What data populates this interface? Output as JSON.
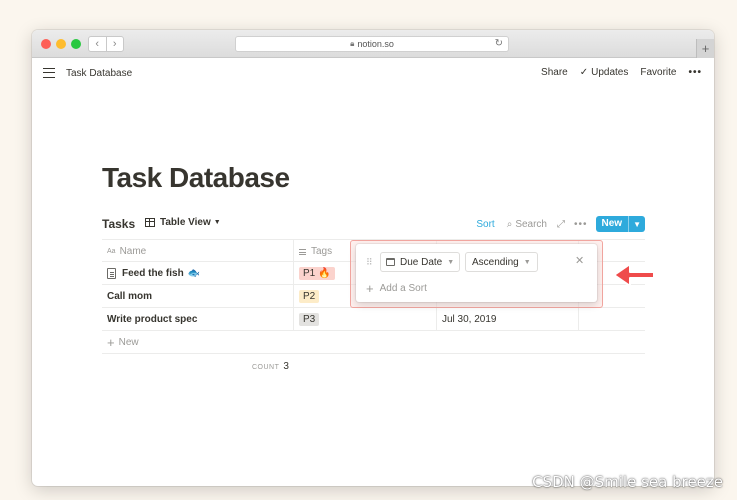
{
  "browser": {
    "url": "notion.so",
    "new_tab_symbol": "+"
  },
  "topbar": {
    "breadcrumb": "Task Database",
    "share_label": "Share",
    "updates_label": "Updates",
    "favorite_label": "Favorite",
    "more_symbol": "•••"
  },
  "page": {
    "title": "Task Database"
  },
  "database": {
    "name": "Tasks",
    "view_label": "Table View",
    "sort_label": "Sort",
    "search_label": "Search",
    "new_label": "New",
    "columns": [
      "Name",
      "Tags"
    ],
    "rows": [
      {
        "name": "Feed the fish",
        "emoji": "🐟",
        "tag": "P1",
        "tag_extra": "🔥",
        "date": ""
      },
      {
        "name": "Call mom",
        "tag": "P2",
        "date": ""
      },
      {
        "name": "Write product spec",
        "tag": "P3",
        "date": "Jul 30, 2019"
      }
    ],
    "new_row_label": "New",
    "count_label": "COUNT",
    "count_value": "3"
  },
  "sort_popup": {
    "property_label": "Due Date",
    "direction_label": "Ascending",
    "add_sort_label": "Add a Sort"
  },
  "help_symbol": "?",
  "watermark": "CSDN @Smile sea breeze",
  "colors": {
    "accent": "#2eaadc",
    "arrow": "#ef4b4b",
    "highlight_border": "#f2a6a0",
    "tag_p1": "#fbd3cd",
    "tag_p2": "#fdecc8",
    "tag_p3": "#e3e2e0"
  }
}
